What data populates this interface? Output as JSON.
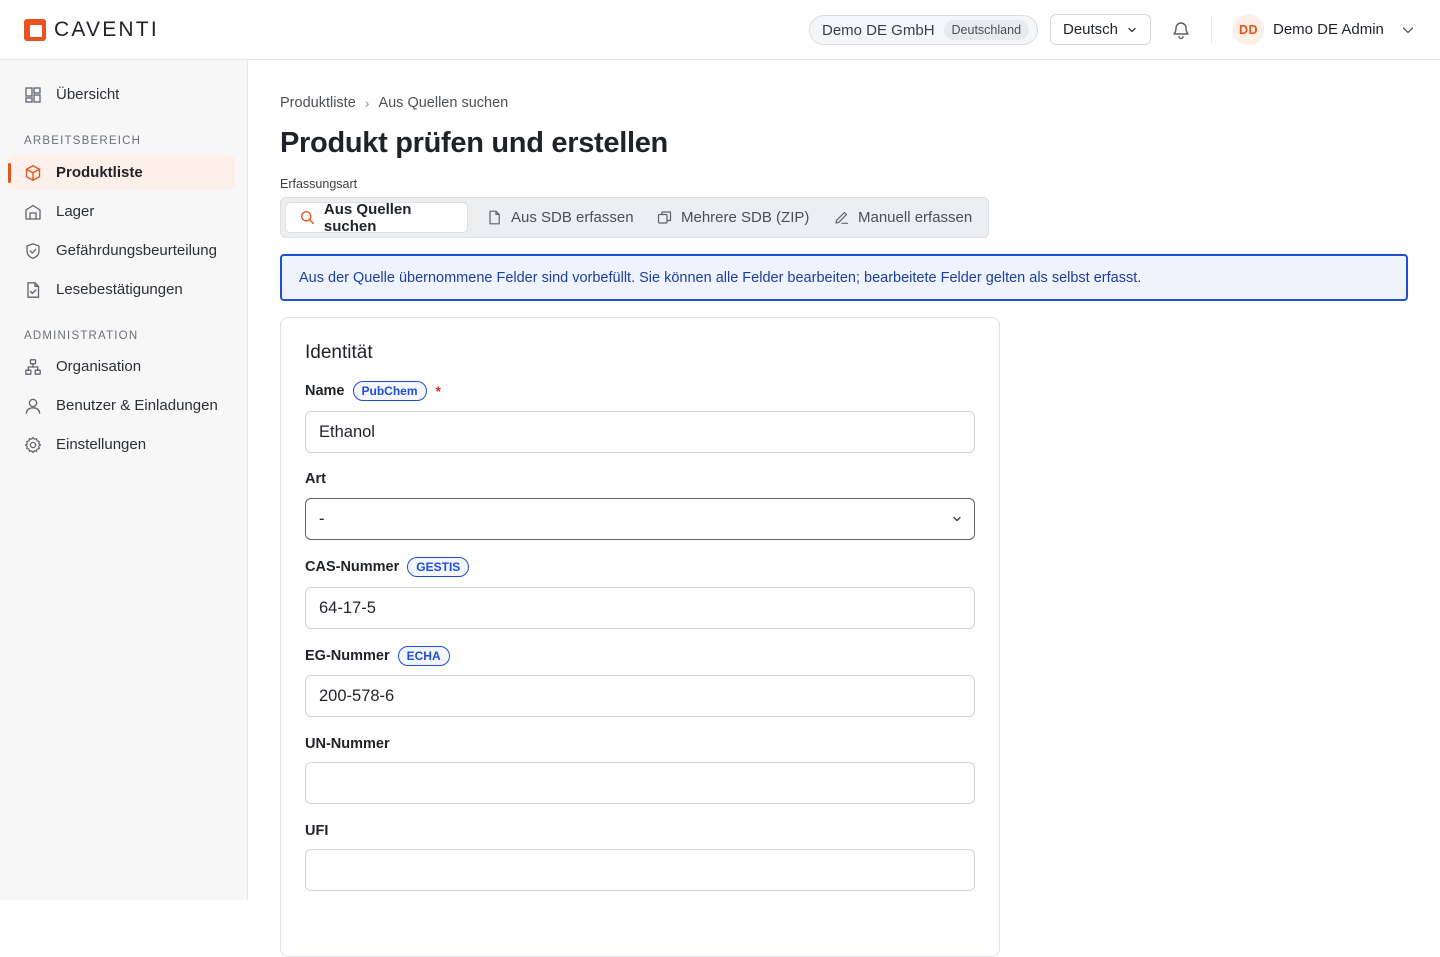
{
  "brand": {
    "name": "CAVENTI",
    "accent": "#E8531F"
  },
  "header": {
    "org_name": "Demo DE GmbH",
    "org_country": "Deutschland",
    "language": "Deutsch",
    "user_initials": "DD",
    "user_name": "Demo DE Admin"
  },
  "sidebar": {
    "overview": "Übersicht",
    "section_workspace": "ARBEITSBEREICH",
    "workspace_items": [
      {
        "label": "Produktliste",
        "icon": "cube-icon",
        "active": true
      },
      {
        "label": "Lager",
        "icon": "warehouse-icon"
      },
      {
        "label": "Gefährdungsbeurteilung",
        "icon": "shield-check-icon"
      },
      {
        "label": "Lesebestätigungen",
        "icon": "document-check-icon"
      }
    ],
    "section_admin": "ADMINISTRATION",
    "admin_items": [
      {
        "label": "Organisation",
        "icon": "org-chart-icon"
      },
      {
        "label": "Benutzer & Einladungen",
        "icon": "user-icon"
      },
      {
        "label": "Einstellungen",
        "icon": "gear-icon"
      }
    ]
  },
  "breadcrumb": {
    "parent": "Produktliste",
    "separator": "›",
    "current": "Aus Quellen suchen"
  },
  "page": {
    "title": "Produkt prüfen und erstellen",
    "mode_caption": "Erfassungsart",
    "mode_tabs": [
      {
        "label": "Aus Quellen suchen",
        "icon": "search-icon",
        "active": true
      },
      {
        "label": "Aus SDB erfassen",
        "icon": "file-icon"
      },
      {
        "label": "Mehrere SDB (ZIP)",
        "icon": "copy-icon"
      },
      {
        "label": "Manuell erfassen",
        "icon": "pencil-icon"
      }
    ],
    "info_banner": "Aus der Quelle übernommene Felder sind vorbefüllt. Sie können alle Felder bearbeiten; bearbeitete Felder gelten als selbst erfasst."
  },
  "identity": {
    "title": "Identität",
    "name": {
      "label": "Name",
      "source": "PubChem",
      "required": "*",
      "value": "Ethanol"
    },
    "art": {
      "label": "Art",
      "value": "-"
    },
    "cas": {
      "label": "CAS-Nummer",
      "source": "GESTIS",
      "value": "64-17-5"
    },
    "eg": {
      "label": "EG-Nummer",
      "source": "ECHA",
      "value": "200-578-6"
    },
    "un": {
      "label": "UN-Nummer",
      "value": ""
    },
    "ufi": {
      "label": "UFI",
      "value": ""
    }
  }
}
